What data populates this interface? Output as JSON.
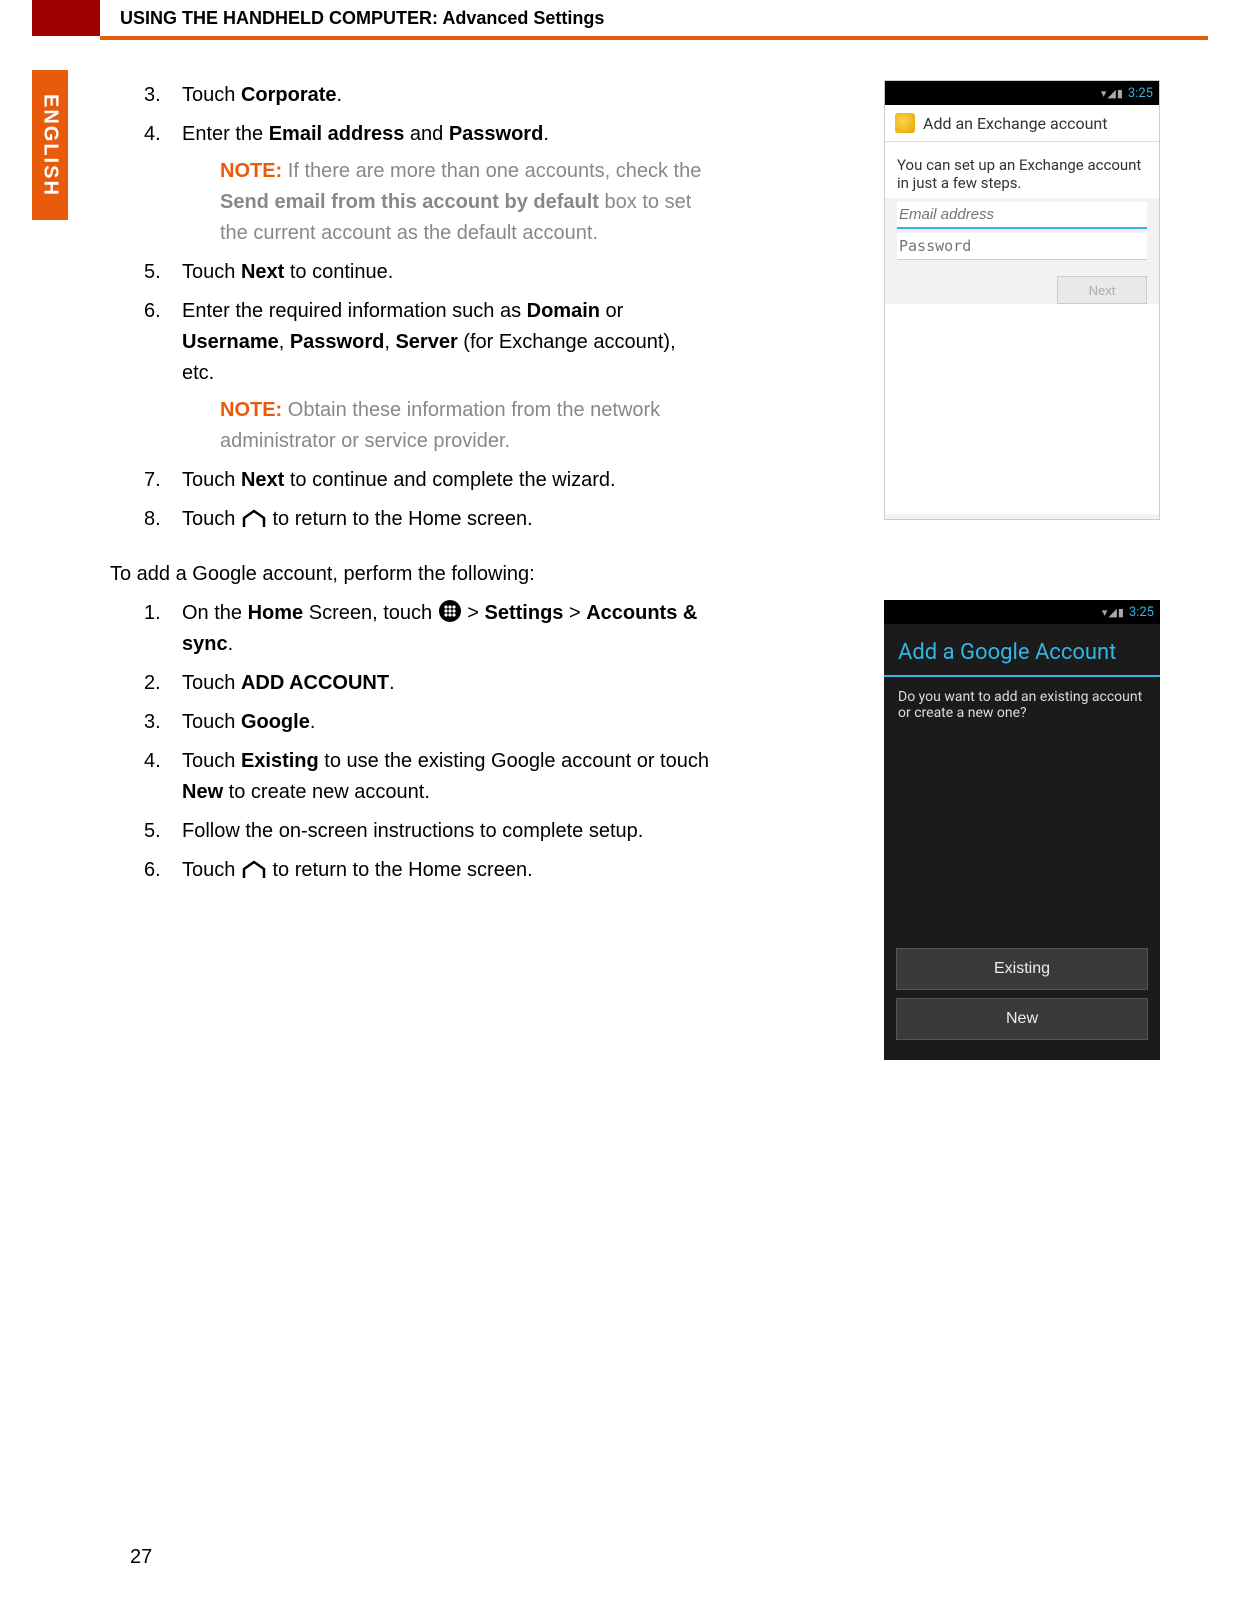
{
  "header": {
    "title": "USING THE HANDHELD COMPUTER: Advanced Settings"
  },
  "language_tab": "ENGLISH",
  "page_number": "27",
  "steps_a": [
    {
      "num": "3.",
      "parts": [
        {
          "t": "Touch "
        },
        {
          "b": "Corporate"
        },
        {
          "t": "."
        }
      ]
    },
    {
      "num": "4.",
      "parts": [
        {
          "t": "Enter the "
        },
        {
          "b": "Email address"
        },
        {
          "t": " and "
        },
        {
          "b": "Password"
        },
        {
          "t": "."
        }
      ],
      "note": {
        "label": "NOTE:",
        "parts": [
          {
            "t": " If there are more than one accounts, check the "
          },
          {
            "b": "Send email from this account by default"
          },
          {
            "t": " box to set the current account as the default account."
          }
        ]
      }
    },
    {
      "num": "5.",
      "parts": [
        {
          "t": "Touch "
        },
        {
          "b": "Next"
        },
        {
          "t": " to continue."
        }
      ]
    },
    {
      "num": "6.",
      "parts": [
        {
          "t": "Enter the required information such as "
        },
        {
          "b": "Domain"
        },
        {
          "t": " or "
        },
        {
          "b": "Username"
        },
        {
          "t": ", "
        },
        {
          "b": "Password"
        },
        {
          "t": ", "
        },
        {
          "b": "Server"
        },
        {
          "t": " (for Exchange account), etc."
        }
      ],
      "note": {
        "label": "NOTE:",
        "parts": [
          {
            "t": " Obtain these information from the network administrator or service provider."
          }
        ]
      }
    },
    {
      "num": "7.",
      "parts": [
        {
          "t": "Touch "
        },
        {
          "b": "Next"
        },
        {
          "t": " to continue and complete the wizard."
        }
      ]
    },
    {
      "num": "8.",
      "parts": [
        {
          "t": "Touch "
        },
        {
          "icon": "home"
        },
        {
          "t": " to return to the Home screen."
        }
      ]
    }
  ],
  "intro_b": "To add a Google account, perform the following:",
  "steps_b": [
    {
      "num": "1.",
      "parts": [
        {
          "t": "On the "
        },
        {
          "b": "Home"
        },
        {
          "t": " Screen, touch "
        },
        {
          "icon": "apps"
        },
        {
          "t": "  > "
        },
        {
          "b": "Settings"
        },
        {
          "t": " > "
        },
        {
          "b": "Accounts & sync"
        },
        {
          "t": "."
        }
      ]
    },
    {
      "num": "2.",
      "parts": [
        {
          "t": "Touch "
        },
        {
          "b": "ADD ACCOUNT"
        },
        {
          "t": "."
        }
      ]
    },
    {
      "num": "3.",
      "parts": [
        {
          "t": "Touch "
        },
        {
          "b": "Google"
        },
        {
          "t": "."
        }
      ]
    },
    {
      "num": "4.",
      "parts": [
        {
          "t": "Touch "
        },
        {
          "b": "Existing"
        },
        {
          "t": " to use the existing Google account or touch "
        },
        {
          "b": "New"
        },
        {
          "t": " to create new account."
        }
      ]
    },
    {
      "num": "5.",
      "parts": [
        {
          "t": "Follow the on-screen instructions to complete setup."
        }
      ]
    },
    {
      "num": "6.",
      "parts": [
        {
          "t": "Touch "
        },
        {
          "icon": "home"
        },
        {
          "t": " to return to the Home screen."
        }
      ]
    }
  ],
  "shot1": {
    "time": "3:25",
    "title": "Add an Exchange account",
    "blurb": "You can set up an Exchange account in just a few steps.",
    "email_ph": "Email address",
    "pw_ph": "Password",
    "next": "Next"
  },
  "shot2": {
    "time": "3:25",
    "title": "Add a Google Account",
    "question": "Do you want to add an existing account or create a new one?",
    "btn_existing": "Existing",
    "btn_new": "New"
  }
}
